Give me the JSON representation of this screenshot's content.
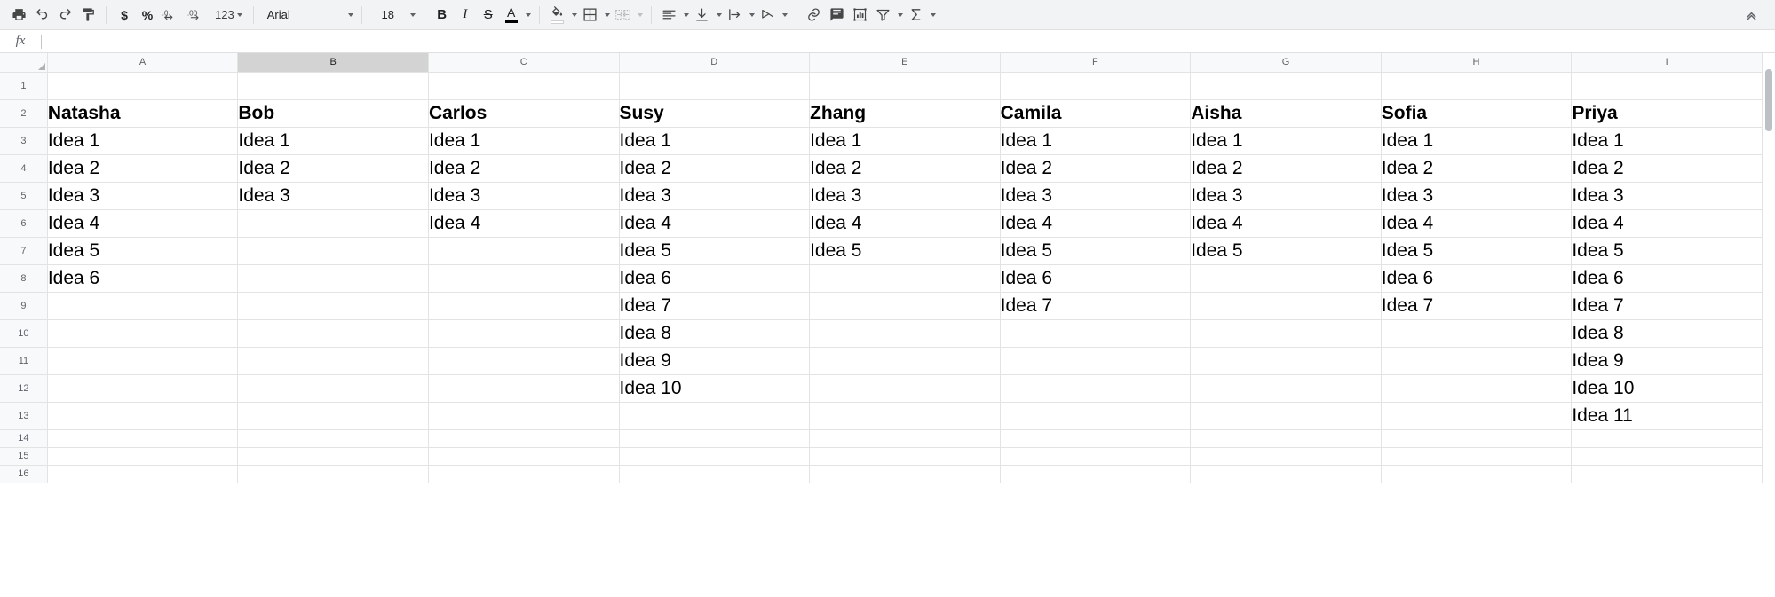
{
  "toolbar": {
    "groups": [
      {
        "items": [
          {
            "name": "print-icon",
            "label": "Print",
            "icon": "print"
          },
          {
            "name": "undo-icon",
            "label": "Undo",
            "icon": "undo"
          },
          {
            "name": "redo-icon",
            "label": "Redo",
            "icon": "redo"
          },
          {
            "name": "paint-format-icon",
            "label": "Paint format",
            "icon": "paint"
          }
        ]
      },
      {
        "items": [
          {
            "name": "currency-icon",
            "label": "$",
            "icon": "text"
          },
          {
            "name": "percent-icon",
            "label": "%",
            "icon": "text"
          },
          {
            "name": "decrease-decimal-icon",
            "label": ".0",
            "icon": "dec-dec"
          },
          {
            "name": "increase-decimal-icon",
            "label": ".00",
            "icon": "inc-dec"
          },
          {
            "name": "number-format-icon",
            "label": "123",
            "icon": "text-caret"
          }
        ]
      }
    ],
    "font_name": "Arial",
    "font_size": "18",
    "bold_label": "B",
    "italic_label": "I",
    "strikethrough_label": "S",
    "text_color_label": "A",
    "collapse_label": "Hide the menus"
  },
  "formula_bar": {
    "fx_label": "fx",
    "value": "",
    "placeholder": ""
  },
  "grid": {
    "corner_label": "",
    "selected_column": "B",
    "columns": [
      "A",
      "B",
      "C",
      "D",
      "E",
      "F",
      "G",
      "H",
      "I"
    ],
    "row_numbers": [
      "1",
      "2",
      "3",
      "4",
      "5",
      "6",
      "7",
      "8",
      "9",
      "10",
      "11",
      "12",
      "13",
      "14",
      "15",
      "16"
    ],
    "rows": [
      {
        "num": "1",
        "height": "tall",
        "cells": [
          "",
          "",
          "",
          "",
          "",
          "",
          "",
          "",
          ""
        ]
      },
      {
        "num": "2",
        "height": "tall",
        "bold": true,
        "cells": [
          "Natasha",
          "Bob",
          "Carlos",
          "Susy",
          "Zhang",
          "Camila",
          "Aisha",
          "Sofia",
          "Priya"
        ]
      },
      {
        "num": "3",
        "height": "tall",
        "cells": [
          "Idea 1",
          "Idea 1",
          "Idea 1",
          "Idea 1",
          "Idea 1",
          "Idea 1",
          "Idea 1",
          "Idea 1",
          "Idea 1"
        ]
      },
      {
        "num": "4",
        "height": "tall",
        "cells": [
          "Idea 2",
          "Idea 2",
          "Idea 2",
          "Idea 2",
          "Idea 2",
          "Idea 2",
          "Idea 2",
          "Idea 2",
          "Idea 2"
        ]
      },
      {
        "num": "5",
        "height": "tall",
        "cells": [
          "Idea 3",
          "Idea 3",
          "Idea 3",
          "Idea 3",
          "Idea 3",
          "Idea 3",
          "Idea 3",
          "Idea 3",
          "Idea 3"
        ]
      },
      {
        "num": "6",
        "height": "tall",
        "cells": [
          "Idea 4",
          "",
          "Idea 4",
          "Idea 4",
          "Idea 4",
          "Idea 4",
          "Idea 4",
          "Idea 4",
          "Idea 4"
        ]
      },
      {
        "num": "7",
        "height": "tall",
        "cells": [
          "Idea 5",
          "",
          "",
          "Idea 5",
          "Idea 5",
          "Idea 5",
          "Idea 5",
          "Idea 5",
          "Idea 5"
        ]
      },
      {
        "num": "8",
        "height": "tall",
        "cells": [
          "Idea 6",
          "",
          "",
          "Idea 6",
          "",
          "Idea 6",
          "",
          "Idea 6",
          "Idea 6"
        ]
      },
      {
        "num": "9",
        "height": "tall",
        "cells": [
          "",
          "",
          "",
          "Idea 7",
          "",
          "Idea 7",
          "",
          "Idea 7",
          "Idea 7"
        ]
      },
      {
        "num": "10",
        "height": "tall",
        "cells": [
          "",
          "",
          "",
          "Idea 8",
          "",
          "",
          "",
          "",
          "Idea 8"
        ]
      },
      {
        "num": "11",
        "height": "tall",
        "cells": [
          "",
          "",
          "",
          "Idea 9",
          "",
          "",
          "",
          "",
          "Idea 9"
        ]
      },
      {
        "num": "12",
        "height": "tall",
        "cells": [
          "",
          "",
          "",
          "Idea 10",
          "",
          "",
          "",
          "",
          "Idea 10"
        ]
      },
      {
        "num": "13",
        "height": "tall",
        "cells": [
          "",
          "",
          "",
          "",
          "",
          "",
          "",
          "",
          "Idea 11"
        ]
      },
      {
        "num": "14",
        "height": "short",
        "cells": [
          "",
          "",
          "",
          "",
          "",
          "",
          "",
          "",
          ""
        ]
      },
      {
        "num": "15",
        "height": "short",
        "cells": [
          "",
          "",
          "",
          "",
          "",
          "",
          "",
          "",
          ""
        ]
      },
      {
        "num": "16",
        "height": "short",
        "cells": [
          "",
          "",
          "",
          "",
          "",
          "",
          "",
          "",
          ""
        ]
      }
    ]
  }
}
